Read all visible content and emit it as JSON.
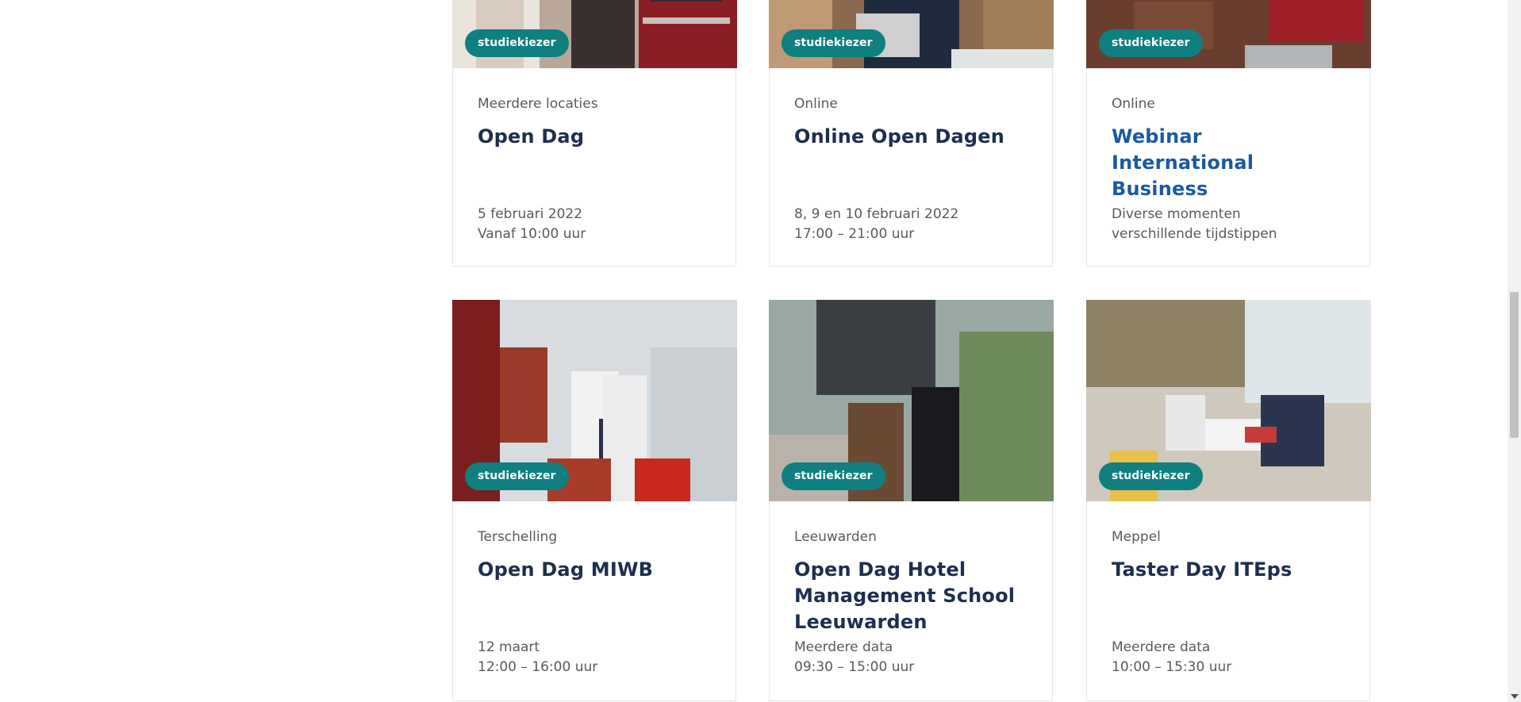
{
  "cards": [
    {
      "badge": "studiekiezer",
      "location": "Meerdere locaties",
      "title": "Open Dag",
      "date": "5 februari 2022",
      "time": "Vanaf 10:00 uur"
    },
    {
      "badge": "studiekiezer",
      "location": "Online",
      "title": "Online Open Dagen",
      "date": "8, 9 en 10 februari 2022",
      "time": "17:00 – 21:00 uur"
    },
    {
      "badge": "studiekiezer",
      "location": "Online",
      "title": "Webinar International Business",
      "date": "Diverse momenten",
      "time": "verschillende tijdstippen"
    },
    {
      "badge": "studiekiezer",
      "location": "Terschelling",
      "title": "Open Dag MIWB",
      "date": "12 maart",
      "time": "12:00 – 16:00 uur"
    },
    {
      "badge": "studiekiezer",
      "location": "Leeuwarden",
      "title": "Open Dag Hotel Management School Leeuwarden",
      "date": "Meerdere data",
      "time": "09:30 – 15:00 uur"
    },
    {
      "badge": "studiekiezer",
      "location": "Meppel",
      "title": "Taster Day ITEps",
      "date": "Meerdere data",
      "time": "10:00 – 15:30 uur"
    }
  ],
  "colors": {
    "badge": "#0f7f80",
    "title": "#1d2e4e",
    "title_link": "#1a5aa0"
  }
}
